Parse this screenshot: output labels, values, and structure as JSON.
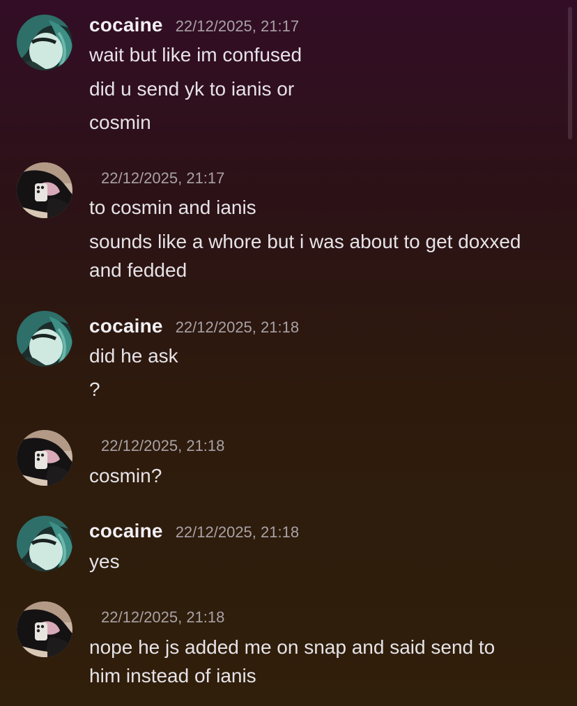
{
  "messages": [
    {
      "author": "cocaine",
      "timestamp": "22/12/2025, 21:17",
      "lines": [
        "wait but like im confused",
        "did u send yk to ianis or",
        "cosmin"
      ]
    },
    {
      "author": "",
      "timestamp": "22/12/2025, 21:17",
      "lines": [
        "to cosmin and ianis",
        "sounds like a whore but i was about to get doxxed",
        "and fedded"
      ]
    },
    {
      "author": "cocaine",
      "timestamp": "22/12/2025, 21:18",
      "lines": [
        "did he ask",
        "?"
      ]
    },
    {
      "author": "",
      "timestamp": "22/12/2025, 21:18",
      "lines": [
        "cosmin?"
      ]
    },
    {
      "author": "cocaine",
      "timestamp": "22/12/2025, 21:18",
      "lines": [
        "yes"
      ]
    },
    {
      "author": "",
      "timestamp": "22/12/2025, 21:18",
      "lines": [
        "nope he js added me on snap and said send to",
        "him instead of ianis"
      ]
    }
  ],
  "colors": {
    "background_top": "#330d26",
    "background_bottom": "#301f0b",
    "author": "#f2f0f4",
    "timestamp": "#a9a2a6",
    "message_text": "#e6e3e8"
  },
  "icons": {
    "avatar_a": "teal-hair-avatar",
    "avatar_b": "mirror-selfie-avatar"
  }
}
